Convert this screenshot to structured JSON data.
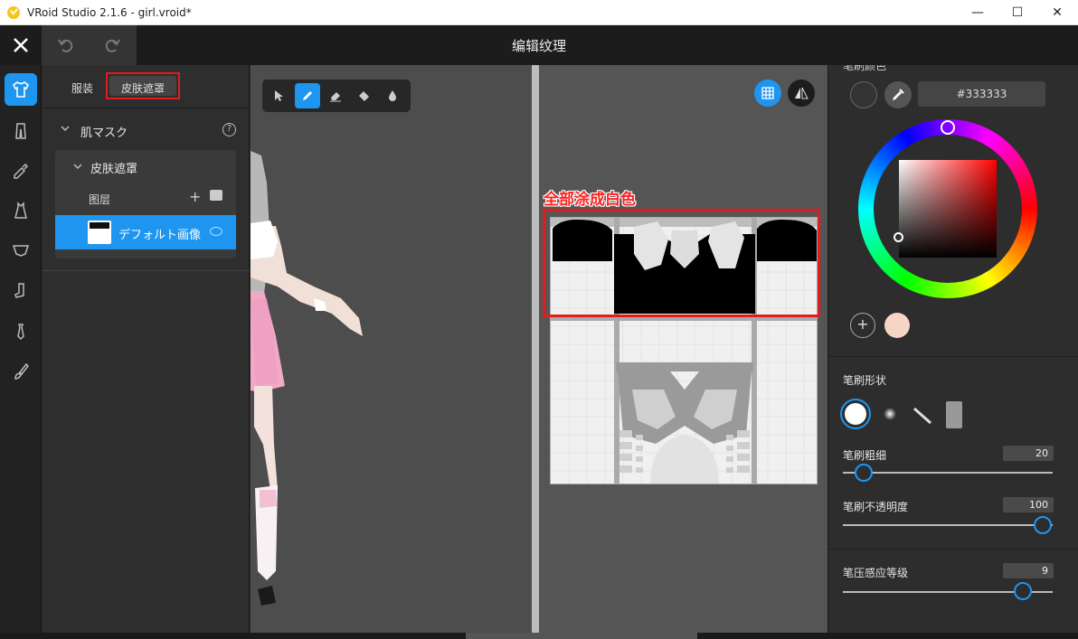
{
  "window": {
    "title": "VRoid Studio 2.1.6 - girl.vroid*",
    "minimize": "—",
    "maximize": "☐",
    "close": "✕"
  },
  "header": {
    "title": "编辑纹理"
  },
  "rail": {
    "items": [
      "shirt-icon",
      "pants-icon",
      "brush-tool-icon",
      "dress-icon",
      "bra-icon",
      "sock-icon",
      "tie-icon",
      "paint-brush-icon"
    ],
    "active": "shirt-icon"
  },
  "left_panel": {
    "tabs": [
      {
        "label": "服装"
      },
      {
        "label": "皮肤遮罩",
        "active": true
      }
    ],
    "section_title": "肌マスク",
    "group_title": "皮肤遮罩",
    "layers_label": "图层",
    "layer_name": "デフォルト画像"
  },
  "viewport": {
    "tools": [
      "select-tool",
      "pen-tool",
      "eraser-tool",
      "fill-tool",
      "blur-tool"
    ],
    "active_tool": "pen-tool"
  },
  "texture_panel": {
    "annotation": "全部涂成白色"
  },
  "right_panel": {
    "partial_title": "笔刷颜色",
    "hex_value": "#333333",
    "current_color": "#333333",
    "saved_swatch": "#f6d5c6",
    "brush_shape_label": "笔刷形状",
    "brush_size_label": "笔刷粗细",
    "brush_size_value": "20",
    "brush_opacity_label": "笔刷不透明度",
    "brush_opacity_value": "100",
    "pressure_label": "笔压感应等级",
    "pressure_value": "9",
    "accent": "#1e96f0"
  }
}
